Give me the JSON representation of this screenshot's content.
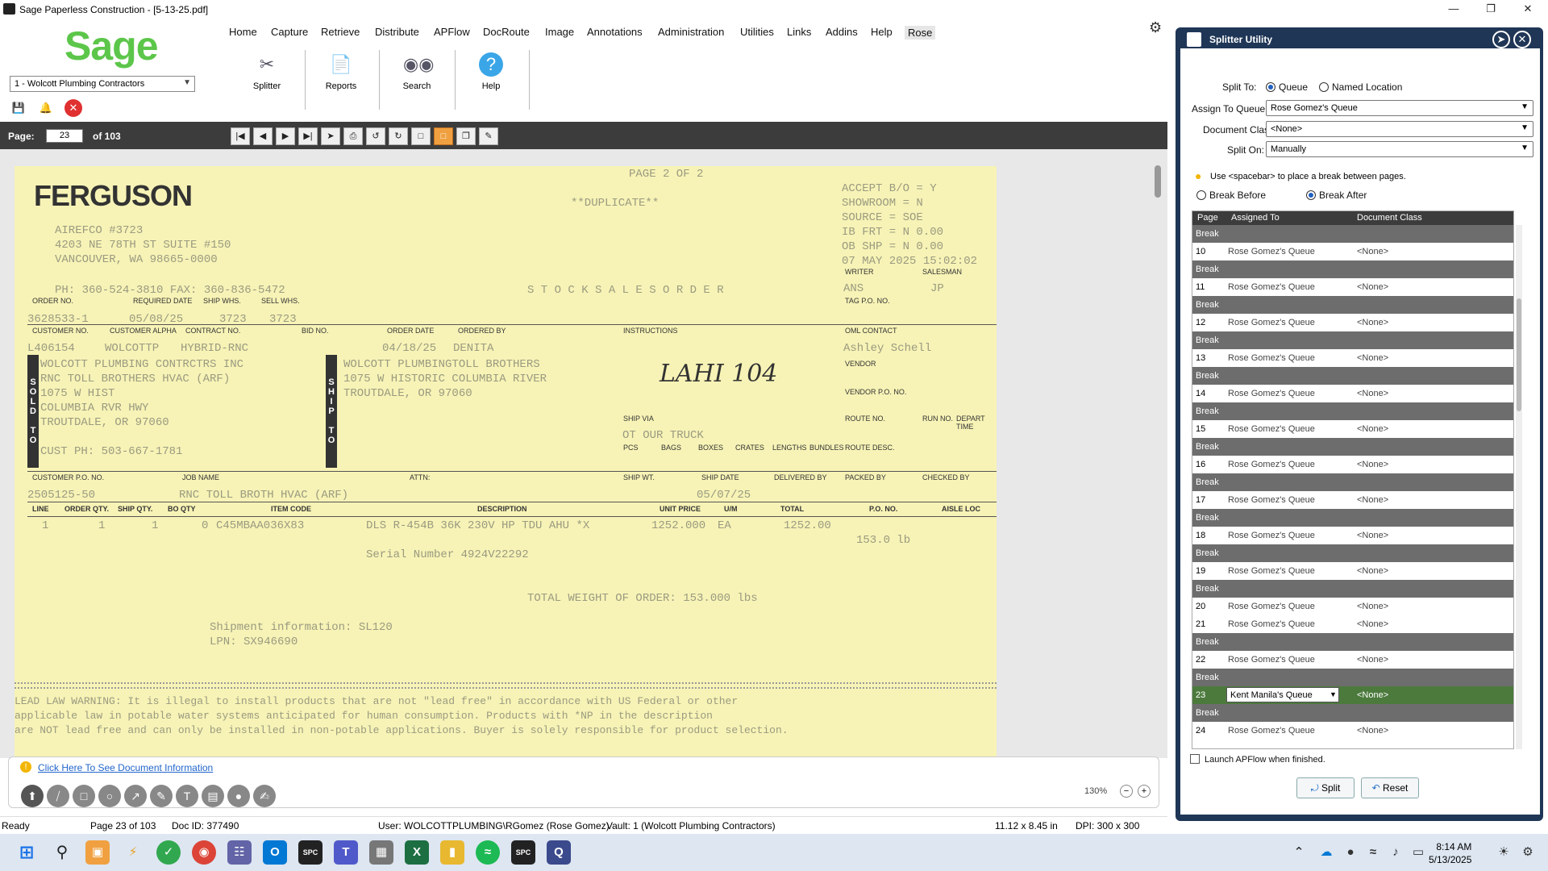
{
  "window": {
    "title": "Sage Paperless Construction - [5-13-25.pdf]"
  },
  "logo": "Sage",
  "vault_select": "1 - Wolcott Plumbing Contractors",
  "menu": [
    "Home",
    "Capture",
    "Retrieve",
    "Distribute",
    "APFlow",
    "DocRoute",
    "Image",
    "Annotations",
    "Administration",
    "Utilities",
    "Links",
    "Addins",
    "Help",
    "Rose"
  ],
  "toolbar": {
    "splitter": "Splitter",
    "reports": "Reports",
    "search": "Search",
    "help": "Help"
  },
  "pagebar": {
    "label": "Page:",
    "current": "23",
    "of": "of 103"
  },
  "document": {
    "company": "FERGUSON",
    "page": "PAGE   2 OF   2",
    "duplicate": "**DUPLICATE**",
    "branch": [
      "AIREFCO #3723",
      "4203 NE 78TH ST SUITE #150",
      "VANCOUVER, WA 98665-0000"
    ],
    "phone": "PH: 360-524-3810    FAX: 360-836-5472",
    "title": "S T O C K   S A L E S   O R D E R",
    "right_info": [
      "ACCEPT B/O = Y",
      "SHOWROOM   = N",
      "SOURCE = SOE",
      "IB FRT = N        0.00",
      "OB SHP = N        0.00",
      "07 MAY 2025 15:02:02"
    ],
    "labels": {
      "order_no": "ORDER NO.",
      "required_date": "REQUIRED DATE",
      "ship_whs": "SHIP WHS.",
      "sell_whs": "SELL WHS.",
      "writer": "WRITER",
      "salesman": "SALESMAN",
      "tag_po": "TAG P.O. NO.",
      "customer_no": "CUSTOMER NO.",
      "customer_alpha": "CUSTOMER ALPHA",
      "contract_no": "CONTRACT NO.",
      "bid_no": "BID NO.",
      "order_date": "ORDER DATE",
      "ordered_by": "ORDERED BY",
      "instructions": "INSTRUCTIONS",
      "oml_contact": "OML CONTACT",
      "vendor": "VENDOR",
      "vendor_po": "VENDOR P.O. NO.",
      "ship_via": "SHIP VIA",
      "route_no": "ROUTE NO.",
      "run_no": "RUN NO.",
      "depart_time": "DEPART TIME",
      "pcs": "PCS",
      "bags": "BAGS",
      "boxes": "BOXES",
      "crates": "CRATES",
      "lengths": "LENGTHS",
      "bundles": "BUNDLES",
      "route_desc": "ROUTE DESC.",
      "customer_po": "CUSTOMER P.O. NO.",
      "job_name": "JOB NAME",
      "attn": "ATTN:",
      "ship_wt": "SHIP WT.",
      "ship_date": "SHIP DATE",
      "delivered_by": "DELIVERED BY",
      "packed_by": "PACKED BY",
      "checked_by": "CHECKED BY"
    },
    "values": {
      "order_no": "3628533-1",
      "required_date": "05/08/25",
      "ship_whs": "3723",
      "sell_whs": "3723",
      "writer": "ANS",
      "salesman": "JP",
      "customer_no": "L406154",
      "customer_alpha": "WOLCOTTP",
      "contract_no": "HYBRID-RNC",
      "order_date": "04/18/25",
      "ordered_by": "DENITA",
      "oml_contact": "Ashley Schell",
      "ship_via": "OT  OUR TRUCK",
      "handwritten": "LAHI 104",
      "customer_po": "2505125-50",
      "job_name": "RNC TOLL BROTH HVAC (ARF)",
      "ship_date": "05/07/25"
    },
    "sold_to": [
      "WOLCOTT PLUMBING CONTRCTRS INC",
      "RNC TOLL BROTHERS HVAC (ARF)",
      "1075 W HIST",
      "COLUMBIA RVR HWY",
      "TROUTDALE, OR 97060",
      "",
      "CUST PH: 503-667-1781"
    ],
    "ship_to": [
      "WOLCOTT PLUMBINGTOLL BROTHERS",
      "1075 W HISTORIC COLUMBIA RIVER",
      "TROUTDALE, OR 97060"
    ],
    "sold_label": "SOLD TO",
    "ship_label": "SHIP TO",
    "line_headers": [
      "LINE",
      "ORDER QTY.",
      "SHIP QTY.",
      "BO QTY",
      "ITEM CODE",
      "DESCRIPTION",
      "UNIT PRICE",
      "U/M",
      "TOTAL",
      "P.O. NO.",
      "AISLE LOC"
    ],
    "line1": [
      "1",
      "1",
      "1",
      "0",
      "C45MBAA036X83",
      "DLS R-454B 36K 230V HP TDU AHU *X",
      "1252.000",
      "EA",
      "1252.00",
      "153.0 lb"
    ],
    "serial": "Serial Number  4924V22292",
    "total_weight": "TOTAL WEIGHT OF ORDER:    153.000 lbs",
    "shipment": [
      "Shipment information: SL120",
      "LPN: SX946690"
    ],
    "lead_warning": [
      "LEAD LAW WARNING: It is illegal to install products that are not \"lead free\" in accordance with US Federal or other",
      "applicable law in potable water systems anticipated for human consumption. Products with *NP in the description",
      "are NOT lead free and can only be installed in non-potable applications. Buyer is solely responsible for product selection."
    ]
  },
  "annotation_panel": {
    "link": "Click Here To See Document Information",
    "zoom": "130%"
  },
  "statusbar": {
    "ready": "Ready",
    "page": "Page 23 of 103",
    "doc_id": "Doc ID: 377490",
    "user": "User: WOLCOTTPLUMBING\\RGomez (Rose Gomez)",
    "vault": "Vault: 1 (Wolcott Plumbing Contractors)",
    "size": "11.12 x 8.45 in",
    "dpi": "DPI: 300 x 300"
  },
  "splitter": {
    "title": "Splitter Utility",
    "split_to_label": "Split To:",
    "opt_queue": "Queue",
    "opt_named": "Named Location",
    "assign_label": "Assign To Queue:",
    "assign_value": "Rose Gomez's Queue",
    "docclass_label": "Document Class:",
    "docclass_value": "<None>",
    "spliton_label": "Split On:",
    "spliton_value": "Manually",
    "hint": "Use <spacebar> to place a break between pages.",
    "break_before": "Break Before",
    "break_after": "Break After",
    "col_page": "Page",
    "col_assigned": "Assigned To",
    "col_class": "Document Class",
    "rows": [
      {
        "type": "break",
        "label": "Break"
      },
      {
        "type": "page",
        "page": "10",
        "assigned": "Rose Gomez's Queue",
        "class": "<None>"
      },
      {
        "type": "break",
        "label": "Break"
      },
      {
        "type": "page",
        "page": "11",
        "assigned": "Rose Gomez's Queue",
        "class": "<None>"
      },
      {
        "type": "break",
        "label": "Break"
      },
      {
        "type": "page",
        "page": "12",
        "assigned": "Rose Gomez's Queue",
        "class": "<None>"
      },
      {
        "type": "break",
        "label": "Break"
      },
      {
        "type": "page",
        "page": "13",
        "assigned": "Rose Gomez's Queue",
        "class": "<None>"
      },
      {
        "type": "break",
        "label": "Break"
      },
      {
        "type": "page",
        "page": "14",
        "assigned": "Rose Gomez's Queue",
        "class": "<None>"
      },
      {
        "type": "break",
        "label": "Break"
      },
      {
        "type": "page",
        "page": "15",
        "assigned": "Rose Gomez's Queue",
        "class": "<None>"
      },
      {
        "type": "break",
        "label": "Break"
      },
      {
        "type": "page",
        "page": "16",
        "assigned": "Rose Gomez's Queue",
        "class": "<None>"
      },
      {
        "type": "break",
        "label": "Break"
      },
      {
        "type": "page",
        "page": "17",
        "assigned": "Rose Gomez's Queue",
        "class": "<None>"
      },
      {
        "type": "break",
        "label": "Break"
      },
      {
        "type": "page",
        "page": "18",
        "assigned": "Rose Gomez's Queue",
        "class": "<None>"
      },
      {
        "type": "break",
        "label": "Break"
      },
      {
        "type": "page",
        "page": "19",
        "assigned": "Rose Gomez's Queue",
        "class": "<None>"
      },
      {
        "type": "break",
        "label": "Break"
      },
      {
        "type": "page",
        "page": "20",
        "assigned": "Rose Gomez's Queue",
        "class": "<None>"
      },
      {
        "type": "page",
        "page": "21",
        "assigned": "Rose Gomez's Queue",
        "class": "<None>"
      },
      {
        "type": "break",
        "label": "Break"
      },
      {
        "type": "page",
        "page": "22",
        "assigned": "Rose Gomez's Queue",
        "class": "<None>"
      },
      {
        "type": "break",
        "label": "Break"
      },
      {
        "type": "selected",
        "page": "23",
        "assigned": "Kent Manila's Queue",
        "class": "<None>"
      },
      {
        "type": "break",
        "label": "Break"
      },
      {
        "type": "page",
        "page": "24",
        "assigned": "Rose Gomez's Queue",
        "class": "<None>"
      }
    ],
    "launch_apflow": "Launch APFlow when finished.",
    "split_button": "Split",
    "reset_button": "Reset"
  },
  "clock": {
    "time": "8:14 AM",
    "date": "5/13/2025"
  }
}
